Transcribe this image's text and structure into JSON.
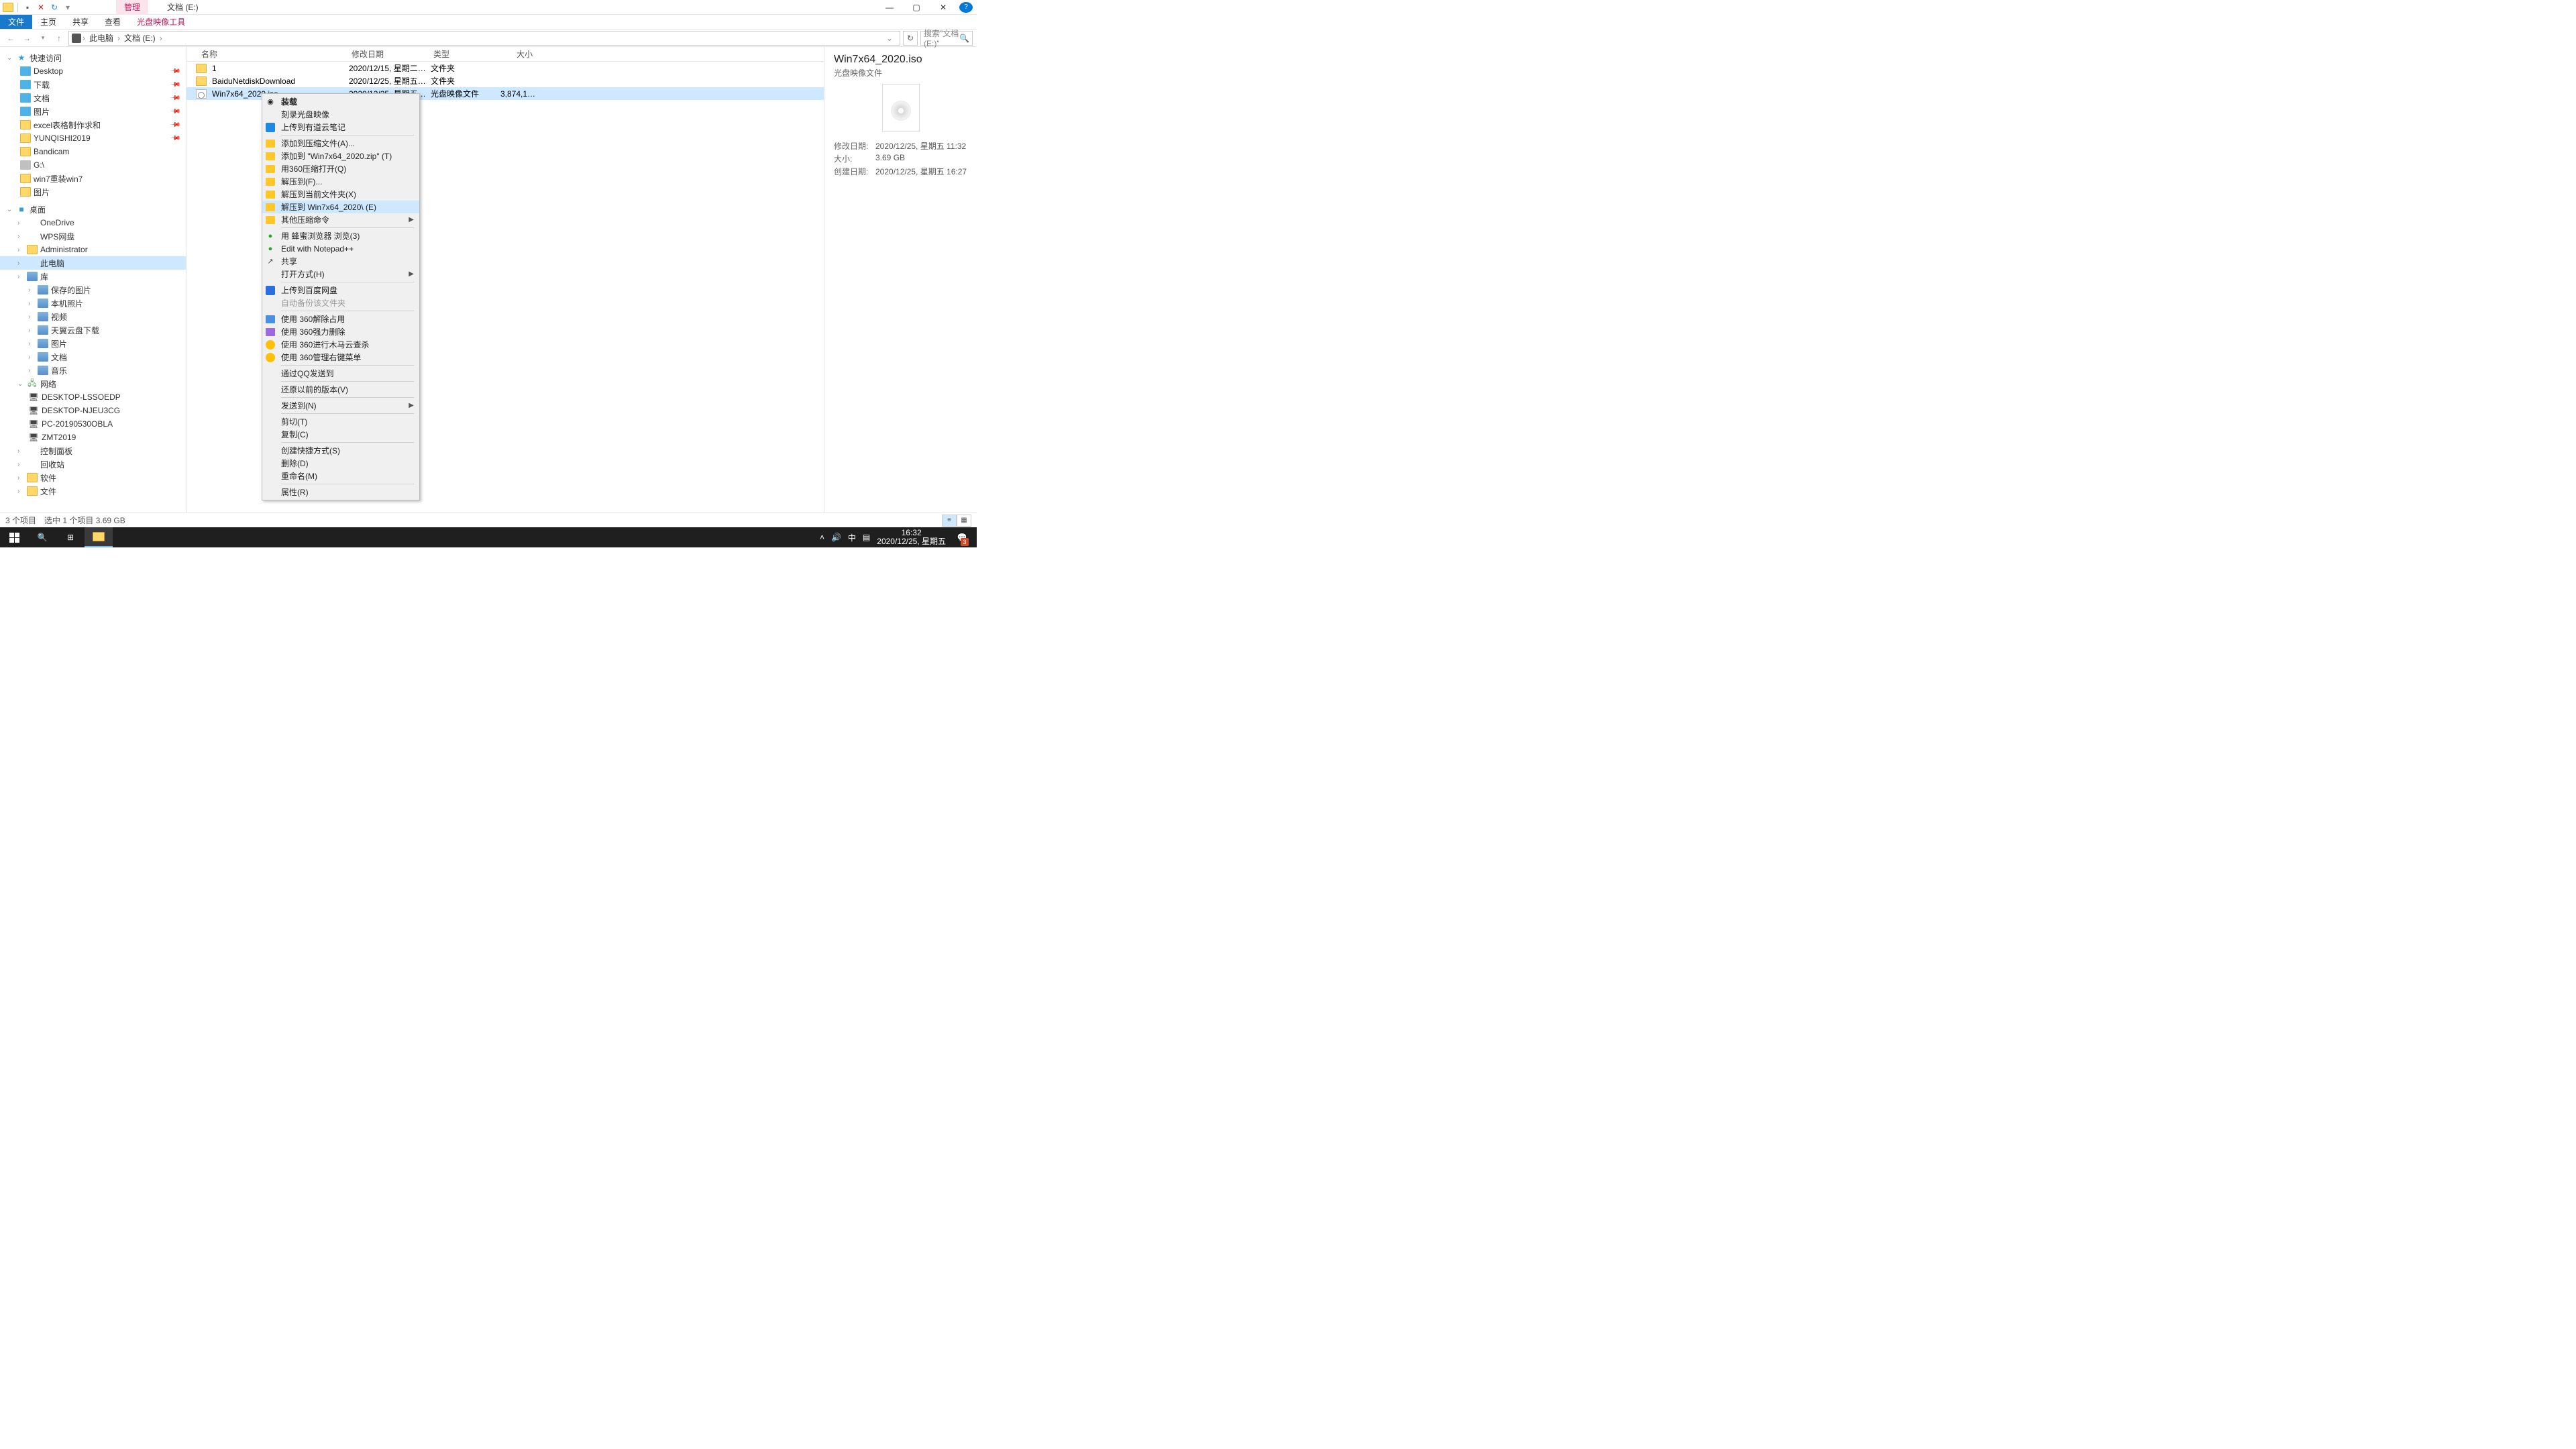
{
  "titlebar": {
    "ribbon_context_tab": "管理",
    "title": "文档 (E:)"
  },
  "ribbon": {
    "tabs": [
      "文件",
      "主页",
      "共享",
      "查看",
      "光盘映像工具"
    ],
    "active": 0
  },
  "address": {
    "crumbs": [
      "此电脑",
      "文档 (E:)"
    ],
    "search_placeholder": "搜索\"文档 (E:)\""
  },
  "tree": {
    "quick_access": "快速访问",
    "quick_items": [
      {
        "label": "Desktop",
        "icon": "blue",
        "pin": true
      },
      {
        "label": "下载",
        "icon": "blue",
        "pin": true
      },
      {
        "label": "文档",
        "icon": "blue",
        "pin": true
      },
      {
        "label": "图片",
        "icon": "blue",
        "pin": true
      },
      {
        "label": "excel表格制作求和",
        "icon": "folder",
        "pin": true
      },
      {
        "label": "YUNQISHI2019",
        "icon": "folder",
        "pin": true
      },
      {
        "label": "Bandicam",
        "icon": "folder"
      },
      {
        "label": "G:\\",
        "icon": "drive"
      },
      {
        "label": "win7重装win7",
        "icon": "folder"
      },
      {
        "label": "图片",
        "icon": "folder"
      }
    ],
    "desktop": "桌面",
    "desktop_items": [
      {
        "label": "OneDrive",
        "icon": "cloud"
      },
      {
        "label": "WPS网盘",
        "icon": "cloud"
      },
      {
        "label": "Administrator",
        "icon": "folder"
      },
      {
        "label": "此电脑",
        "icon": "monitor",
        "selected": true
      },
      {
        "label": "库",
        "icon": "lib"
      }
    ],
    "lib_items": [
      {
        "label": "保存的图片"
      },
      {
        "label": "本机照片"
      },
      {
        "label": "视频"
      },
      {
        "label": "天翼云盘下载"
      },
      {
        "label": "图片"
      },
      {
        "label": "文档"
      },
      {
        "label": "音乐"
      }
    ],
    "network": "网络",
    "network_items": [
      {
        "label": "DESKTOP-LSSOEDP"
      },
      {
        "label": "DESKTOP-NJEU3CG"
      },
      {
        "label": "PC-20190530OBLA"
      },
      {
        "label": "ZMT2019"
      }
    ],
    "others": [
      {
        "label": "控制面板",
        "icon": "monitor"
      },
      {
        "label": "回收站",
        "icon": "monitor"
      },
      {
        "label": "软件",
        "icon": "folder"
      },
      {
        "label": "文件",
        "icon": "folder"
      }
    ]
  },
  "columns": {
    "name": "名称",
    "date": "修改日期",
    "type": "类型",
    "size": "大小"
  },
  "rows": [
    {
      "name": "1",
      "date": "2020/12/15, 星期二 1...",
      "type": "文件夹",
      "size": "",
      "icon": "folder"
    },
    {
      "name": "BaiduNetdiskDownload",
      "date": "2020/12/25, 星期五 1...",
      "type": "文件夹",
      "size": "",
      "icon": "folder"
    },
    {
      "name": "Win7x64_2020.iso",
      "date": "2020/12/25, 星期五 1...",
      "type": "光盘映像文件",
      "size": "3,874,126...",
      "icon": "iso",
      "selected": true
    }
  ],
  "context_menu": [
    {
      "label": "装载",
      "icon": "disc",
      "bold": true
    },
    {
      "label": "刻录光盘映像"
    },
    {
      "label": "上传到有道云笔记",
      "icon": "ynote"
    },
    {
      "sep": true
    },
    {
      "label": "添加到压缩文件(A)...",
      "icon": "archive"
    },
    {
      "label": "添加到 \"Win7x64_2020.zip\" (T)",
      "icon": "archive"
    },
    {
      "label": "用360压缩打开(Q)",
      "icon": "archive"
    },
    {
      "label": "解压到(F)...",
      "icon": "archive"
    },
    {
      "label": "解压到当前文件夹(X)",
      "icon": "archive"
    },
    {
      "label": "解压到 Win7x64_2020\\ (E)",
      "icon": "archive",
      "hover": true
    },
    {
      "label": "其他压缩命令",
      "icon": "archive",
      "submenu": true
    },
    {
      "sep": true
    },
    {
      "label": "用 蜂蜜浏览器 浏览(3)",
      "icon": "green-dot"
    },
    {
      "label": "Edit with Notepad++",
      "icon": "green-dot"
    },
    {
      "label": "共享",
      "icon": "share"
    },
    {
      "label": "打开方式(H)",
      "submenu": true
    },
    {
      "sep": true
    },
    {
      "label": "上传到百度网盘",
      "icon": "baidu"
    },
    {
      "label": "自动备份该文件夹",
      "disabled": true
    },
    {
      "sep": true
    },
    {
      "label": "使用 360解除占用",
      "icon": "360b"
    },
    {
      "label": "使用 360强力删除",
      "icon": "purple"
    },
    {
      "label": "使用 360进行木马云查杀",
      "icon": "yellow"
    },
    {
      "label": "使用 360管理右键菜单",
      "icon": "yellow"
    },
    {
      "sep": true
    },
    {
      "label": "通过QQ发送到"
    },
    {
      "sep": true
    },
    {
      "label": "还原以前的版本(V)"
    },
    {
      "sep": true
    },
    {
      "label": "发送到(N)",
      "submenu": true
    },
    {
      "sep": true
    },
    {
      "label": "剪切(T)"
    },
    {
      "label": "复制(C)"
    },
    {
      "sep": true
    },
    {
      "label": "创建快捷方式(S)"
    },
    {
      "label": "删除(D)"
    },
    {
      "label": "重命名(M)"
    },
    {
      "sep": true
    },
    {
      "label": "属性(R)"
    }
  ],
  "preview": {
    "title": "Win7x64_2020.iso",
    "subtitle": "光盘映像文件",
    "meta": [
      {
        "k": "修改日期:",
        "v": "2020/12/25, 星期五 11:32"
      },
      {
        "k": "大小:",
        "v": "3.69 GB"
      },
      {
        "k": "创建日期:",
        "v": "2020/12/25, 星期五 16:27"
      }
    ]
  },
  "status": {
    "count": "3 个项目",
    "selection": "选中 1 个项目  3.69 GB"
  },
  "taskbar": {
    "ime": "中",
    "time": "16:32",
    "date": "2020/12/25, 星期五",
    "notif_count": "3"
  }
}
